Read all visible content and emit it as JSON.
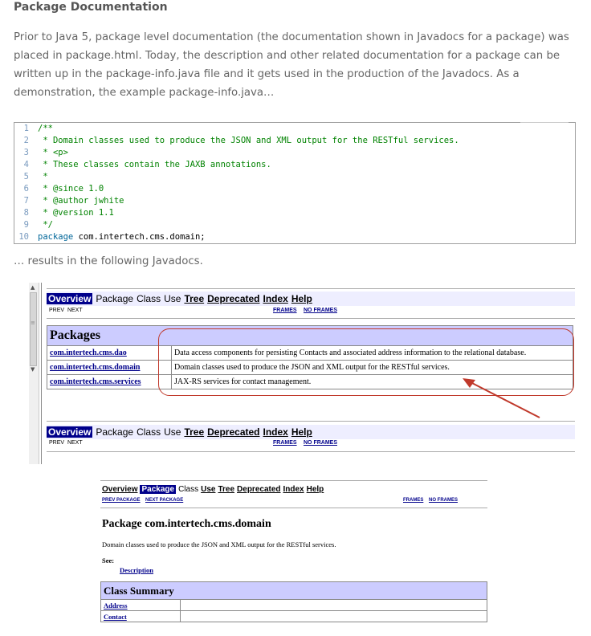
{
  "article": {
    "heading": "Package Documentation",
    "paragraph_lines": [
      "Prior to Java 5, package level documentation (the documentation shown in Javadocs for a package) was",
      "placed in package.html.  Today, the description and other related documentation for a package can be",
      "written up in the package-info.java file and it gets used in the production of the Javadocs.  As a",
      "demonstration, the example package-info.java…"
    ],
    "results_text": "… results in the following Javadocs."
  },
  "code": {
    "lines": [
      {
        "n": "1",
        "text": "/**"
      },
      {
        "n": "2",
        "text": " * Domain classes used to produce the JSON and XML output for the RESTful services."
      },
      {
        "n": "3",
        "text": " * <p>"
      },
      {
        "n": "4",
        "text": " * These classes contain the JAXB annotations."
      },
      {
        "n": "5",
        "text": " *"
      },
      {
        "n": "6",
        "text": " * @since 1.0"
      },
      {
        "n": "7",
        "text": " * @author jwhite"
      },
      {
        "n": "8",
        "text": " * @version 1.1"
      },
      {
        "n": "9",
        "text": " */"
      },
      {
        "n": "10",
        "keyword": "package",
        "text": " com.intertech.cms.domain;"
      }
    ]
  },
  "javadoc_overview": {
    "nav": {
      "overview": "Overview",
      "package": "Package",
      "class": "Class",
      "use": "Use",
      "tree": "Tree",
      "deprecated": "Deprecated",
      "index": "Index",
      "help": "Help"
    },
    "subnav": {
      "prev": "PREV",
      "next": "NEXT",
      "frames": "FRAMES",
      "no_frames": "NO FRAMES"
    },
    "packages_header": "Packages",
    "packages": [
      {
        "name": "com.intertech.cms.dao",
        "desc": "Data access components for persisting Contacts and associated address information to the relational database."
      },
      {
        "name": "com.intertech.cms.domain",
        "desc": "Domain classes used to produce the JSON and XML output for the RESTful services."
      },
      {
        "name": "com.intertech.cms.services",
        "desc": "JAX-RS services for contact management."
      }
    ]
  },
  "javadoc_package": {
    "nav": {
      "overview": "Overview",
      "package": "Package",
      "class": "Class",
      "use": "Use",
      "tree": "Tree",
      "deprecated": "Deprecated",
      "index": "Index",
      "help": "Help"
    },
    "subnav": {
      "prev_package": "PREV PACKAGE",
      "next_package": "NEXT PACKAGE",
      "frames": "FRAMES",
      "no_frames": "NO FRAMES"
    },
    "title": "Package com.intertech.cms.domain",
    "description": "Domain classes used to produce the JSON and XML output for the RESTful services.",
    "see_label": "See:",
    "see_link": "Description",
    "class_summary_header": "Class Summary",
    "classes": [
      "Address",
      "Contact"
    ]
  },
  "colors": {
    "annotation": "#c0392b",
    "nav_active": "#00008b",
    "table_header": "#ccccff",
    "nav_bg": "#eeeeff"
  }
}
